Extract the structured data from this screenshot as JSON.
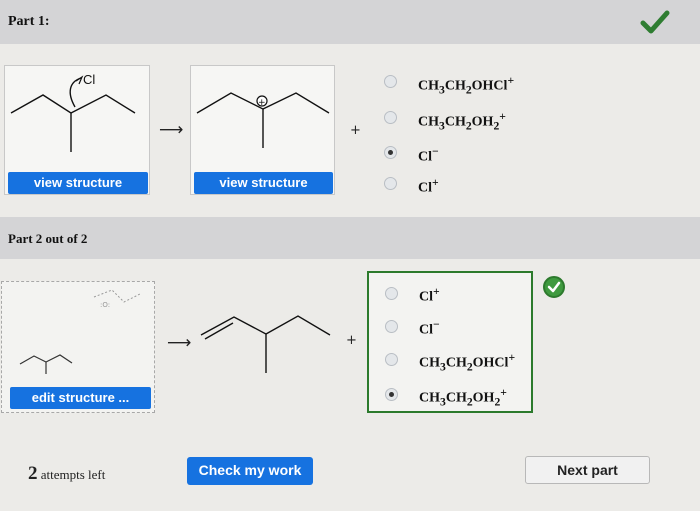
{
  "part1": {
    "title": "Part 1:",
    "reactant_label": "Cl",
    "view_structure_1": "view structure",
    "view_structure_2": "view structure",
    "plus": "+",
    "options": [
      {
        "main": "CH",
        "s1": "3",
        "m2": "CH",
        "s2": "2",
        "m3": "OHCl",
        "sup": "+",
        "selected": false
      },
      {
        "main": "CH",
        "s1": "3",
        "m2": "CH",
        "s2": "2",
        "m3": "OH",
        "s3": "2",
        "sup": "+",
        "selected": false
      },
      {
        "main": "Cl",
        "sup": "−",
        "selected": true
      },
      {
        "main": "Cl",
        "sup": "+",
        "selected": false
      }
    ]
  },
  "part2": {
    "title": "Part 2 out of 2",
    "edit_structure": "edit structure ...",
    "plus": "+",
    "options": [
      {
        "main": "Cl",
        "sup": "+",
        "selected": false
      },
      {
        "main": "Cl",
        "sup": "−",
        "selected": false
      },
      {
        "main": "CH",
        "s1": "3",
        "m2": "CH",
        "s2": "2",
        "m3": "OHCl",
        "sup": "+",
        "selected": false
      },
      {
        "main": "CH",
        "s1": "3",
        "m2": "CH",
        "s2": "2",
        "m3": "OH",
        "s3": "2",
        "sup": "+",
        "selected": true
      }
    ]
  },
  "footer": {
    "attempts_count": "2",
    "attempts_text": "attempts left",
    "check_label": "Check my work",
    "next_label": "Next part"
  },
  "icons": {
    "part1_status": "checkmark-icon",
    "part2_status": "check-circle-icon",
    "arrow": "right-arrow-icon"
  },
  "colors": {
    "accent": "#1672e0",
    "success": "#3f9a3f"
  }
}
